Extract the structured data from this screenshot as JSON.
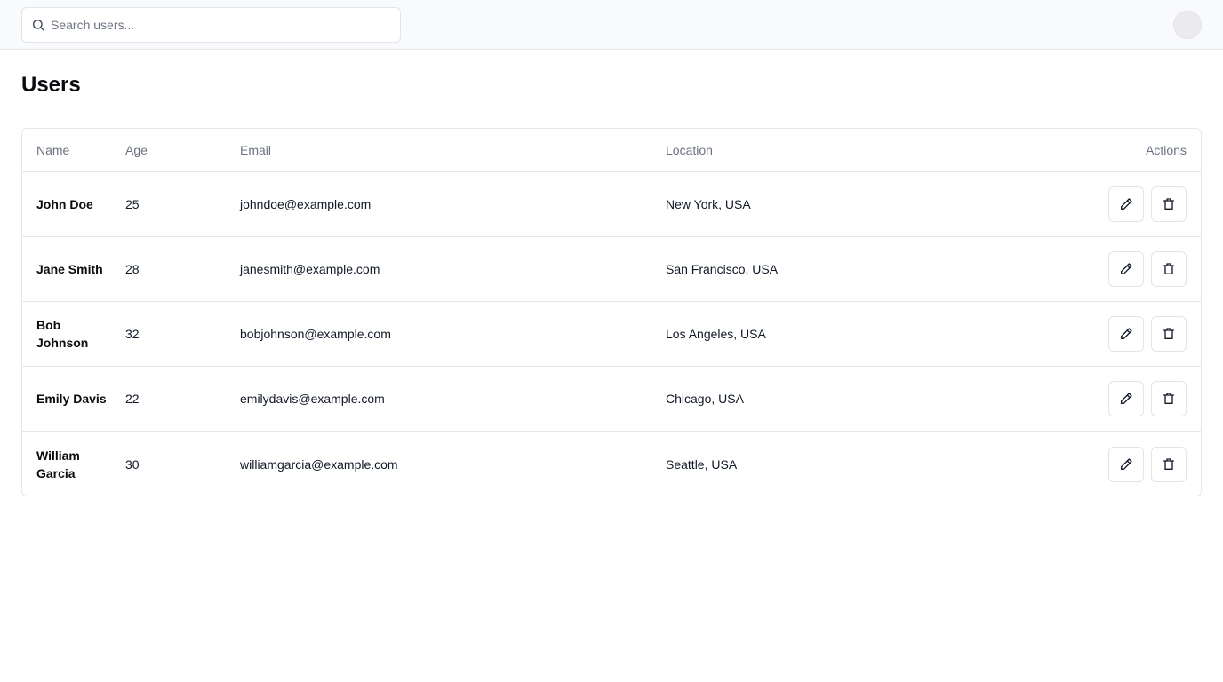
{
  "search": {
    "placeholder": "Search users...",
    "value": ""
  },
  "page": {
    "title": "Users"
  },
  "table": {
    "headers": {
      "name": "Name",
      "age": "Age",
      "email": "Email",
      "location": "Location",
      "actions": "Actions"
    },
    "rows": [
      {
        "name": "John Doe",
        "age": "25",
        "email": "johndoe@example.com",
        "location": "New York, USA"
      },
      {
        "name": "Jane Smith",
        "age": "28",
        "email": "janesmith@example.com",
        "location": "San Francisco, USA"
      },
      {
        "name": "Bob Johnson",
        "age": "32",
        "email": "bobjohnson@example.com",
        "location": "Los Angeles, USA"
      },
      {
        "name": "Emily Davis",
        "age": "22",
        "email": "emilydavis@example.com",
        "location": "Chicago, USA"
      },
      {
        "name": "William Garcia",
        "age": "30",
        "email": "williamgarcia@example.com",
        "location": "Seattle, USA"
      }
    ],
    "row_actions": {
      "edit_icon": "pencil-icon",
      "delete_icon": "trash-icon"
    }
  },
  "icons": {
    "search": "search-icon",
    "avatar": "avatar"
  },
  "colors": {
    "topbar_bg": "#f8fafb",
    "border": "#e5e7eb",
    "header_text": "#6b7280"
  }
}
